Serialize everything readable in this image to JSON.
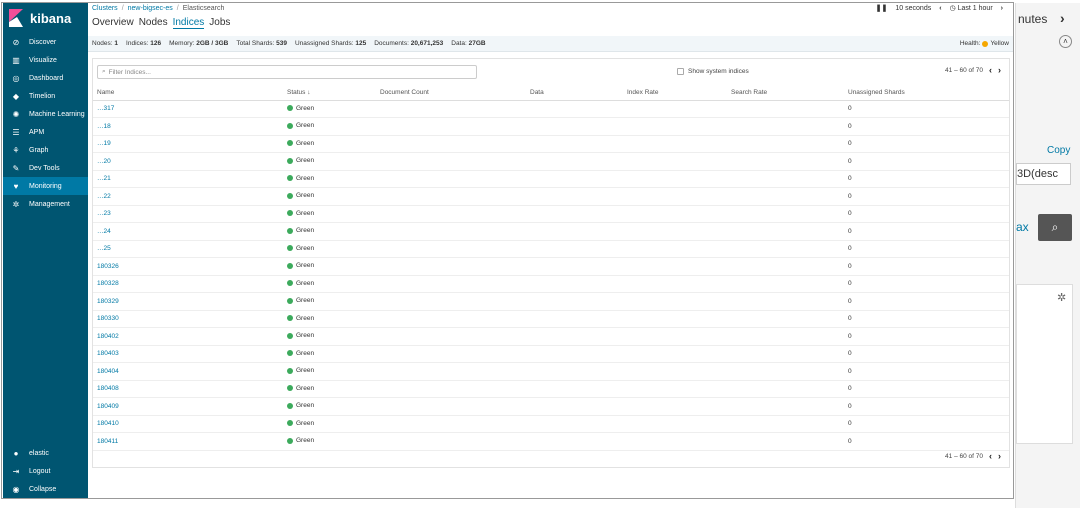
{
  "sidebar": {
    "brand": "kibana",
    "items": [
      {
        "label": "Discover",
        "icon": "compass-icon",
        "glyph": "⊘"
      },
      {
        "label": "Visualize",
        "icon": "bar-chart-icon",
        "glyph": "▥"
      },
      {
        "label": "Dashboard",
        "icon": "dashboard-icon",
        "glyph": "◎"
      },
      {
        "label": "Timelion",
        "icon": "shield-icon",
        "glyph": "◆"
      },
      {
        "label": "Machine Learning",
        "icon": "ml-icon",
        "glyph": "✺"
      },
      {
        "label": "APM",
        "icon": "apm-icon",
        "glyph": "☰"
      },
      {
        "label": "Graph",
        "icon": "graph-icon",
        "glyph": "⚘"
      },
      {
        "label": "Dev Tools",
        "icon": "wrench-icon",
        "glyph": "✎"
      },
      {
        "label": "Monitoring",
        "icon": "heartbeat-icon",
        "glyph": "♥"
      },
      {
        "label": "Management",
        "icon": "gear-icon",
        "glyph": "✲"
      }
    ],
    "bottom": [
      {
        "label": "elastic",
        "icon": "user-icon",
        "glyph": "●"
      },
      {
        "label": "Logout",
        "icon": "logout-icon",
        "glyph": "⇥"
      },
      {
        "label": "Collapse",
        "icon": "collapse-icon",
        "glyph": "◉"
      }
    ]
  },
  "breadcrumb": [
    "Clusters",
    "new-bigsec-es",
    "Elasticsearch"
  ],
  "tabs": [
    "Overview",
    "Nodes",
    "Indices",
    "Jobs"
  ],
  "refresh": {
    "interval": "10 seconds",
    "range": "Last 1 hour"
  },
  "stats": {
    "nodes_label": "Nodes:",
    "nodes": "1",
    "indices_label": "Indices:",
    "indices": "126",
    "memory_label": "Memory:",
    "memory": "2GB / 3GB",
    "shards_label": "Total Shards:",
    "shards": "539",
    "unassigned_label": "Unassigned Shards:",
    "unassigned": "125",
    "docs_label": "Documents:",
    "docs": "20,671,253",
    "data_label": "Data:",
    "data": "27GB",
    "health_label": "Health:",
    "health": "Yellow",
    "health_color": "#f5a700"
  },
  "filter": {
    "placeholder": "Filter Indices..."
  },
  "system_indices_label": "Show system indices",
  "pager_text": "41 – 60 of 70",
  "columns": [
    "Name",
    "Status ↓",
    "Document Count",
    "Data",
    "Index Rate",
    "Search Rate",
    "Unassigned Shards"
  ],
  "rows": [
    {
      "name": "…317",
      "status": "Green",
      "unassigned": "0"
    },
    {
      "name": "…18",
      "status": "Green",
      "unassigned": "0"
    },
    {
      "name": "…19",
      "status": "Green",
      "unassigned": "0"
    },
    {
      "name": "…20",
      "status": "Green",
      "unassigned": "0"
    },
    {
      "name": "…21",
      "status": "Green",
      "unassigned": "0"
    },
    {
      "name": "…22",
      "status": "Green",
      "unassigned": "0"
    },
    {
      "name": "…23",
      "status": "Green",
      "unassigned": "0"
    },
    {
      "name": "…24",
      "status": "Green",
      "unassigned": "0"
    },
    {
      "name": "…25",
      "status": "Green",
      "unassigned": "0"
    },
    {
      "name": "180326",
      "status": "Green",
      "unassigned": "0"
    },
    {
      "name": "180328",
      "status": "Green",
      "unassigned": "0"
    },
    {
      "name": "180329",
      "status": "Green",
      "unassigned": "0"
    },
    {
      "name": "180330",
      "status": "Green",
      "unassigned": "0"
    },
    {
      "name": "180402",
      "status": "Green",
      "unassigned": "0"
    },
    {
      "name": "180403",
      "status": "Green",
      "unassigned": "0"
    },
    {
      "name": "180404",
      "status": "Green",
      "unassigned": "0"
    },
    {
      "name": "180408",
      "status": "Green",
      "unassigned": "0"
    },
    {
      "name": "180409",
      "status": "Green",
      "unassigned": "0"
    },
    {
      "name": "180410",
      "status": "Green",
      "unassigned": "0"
    },
    {
      "name": "180411",
      "status": "Green",
      "unassigned": "0"
    }
  ],
  "status_color": "#3caa5c",
  "right_panel": {
    "t1": "nutes",
    "t2": "Copy",
    "t3": "3D(desc",
    "t4": "ax"
  }
}
